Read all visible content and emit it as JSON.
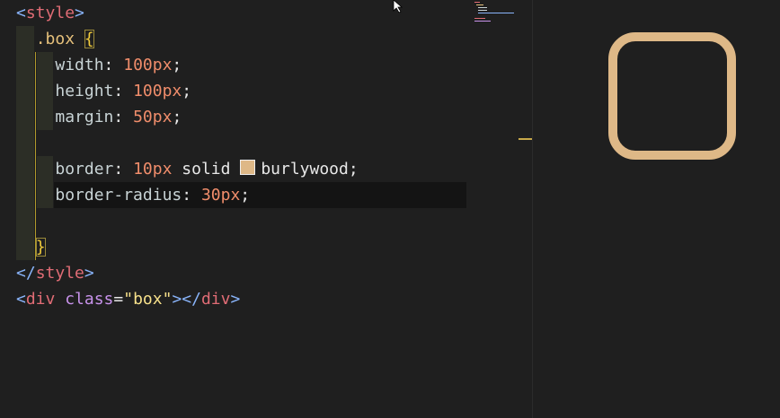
{
  "editor": {
    "lines": {
      "l1": {
        "open": "<",
        "tag": "style",
        "close": ">"
      },
      "l2": {
        "selector": ".box",
        "brace": "{"
      },
      "l3": {
        "prop": "width",
        "colon": ":",
        "num": "100px",
        "semi": ";"
      },
      "l4": {
        "prop": "height",
        "colon": ":",
        "num": "100px",
        "semi": ";"
      },
      "l5": {
        "prop": "margin",
        "colon": ":",
        "num": "50px",
        "semi": ";"
      },
      "l7": {
        "prop": "border",
        "colon": ":",
        "num": "10px",
        "kw": "solid",
        "color_name": "burlywood",
        "semi": ";"
      },
      "l8": {
        "prop": "border-radius",
        "colon": ":",
        "num": "30px",
        "semi": ";"
      },
      "l10": {
        "brace": "}"
      },
      "l11": {
        "open": "</",
        "tag": "style",
        "close": ">"
      },
      "l12": {
        "open": "<",
        "tag": "div",
        "attr": "class",
        "eq": "=",
        "quote": "\"",
        "value": "box",
        "close": ">",
        "close_open": "</",
        "close_tag": "div",
        "close_end": ">"
      }
    }
  },
  "preview": {
    "box_border_color": "#deb887"
  },
  "colors": {
    "background": "#1f1f1f",
    "burlywood": "#deb887"
  }
}
